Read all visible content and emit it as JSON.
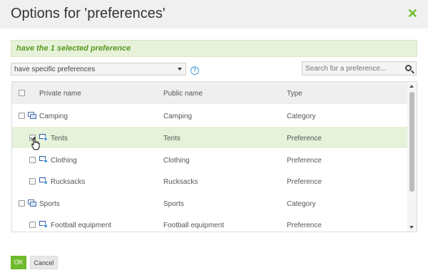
{
  "dialog": {
    "title": "Options for 'preferences'",
    "close_icon": "close-icon"
  },
  "banner": {
    "text": "have the 1 selected preference"
  },
  "filter": {
    "selected": "have specific preferences",
    "help_icon": "help-icon"
  },
  "search": {
    "placeholder": "Search for a preference...",
    "icon": "search-icon"
  },
  "table": {
    "columns": [
      "Private name",
      "Public name",
      "Type"
    ],
    "rows": [
      {
        "private": "Camping",
        "public": "Camping",
        "type": "Category",
        "level": 0,
        "checked": false,
        "selected": false
      },
      {
        "private": "Tents",
        "public": "Tents",
        "type": "Preference",
        "level": 1,
        "checked": true,
        "selected": true
      },
      {
        "private": "Clothing",
        "public": "Clothing",
        "type": "Preference",
        "level": 1,
        "checked": false,
        "selected": false
      },
      {
        "private": "Rucksacks",
        "public": "Rucksacks",
        "type": "Preference",
        "level": 1,
        "checked": false,
        "selected": false
      },
      {
        "private": "Sports",
        "public": "Sports",
        "type": "Category",
        "level": 0,
        "checked": false,
        "selected": false
      },
      {
        "private": "Football equipment",
        "public": "Football equipment",
        "type": "Preference",
        "level": 1,
        "checked": false,
        "selected": false
      }
    ]
  },
  "footer": {
    "ok_label": "OK",
    "cancel_label": "Cancel"
  },
  "colors": {
    "accent": "#6fba2c",
    "banner_bg": "#e6f2d9",
    "banner_text": "#5a9a23",
    "selected_row": "#e6f2d9"
  }
}
